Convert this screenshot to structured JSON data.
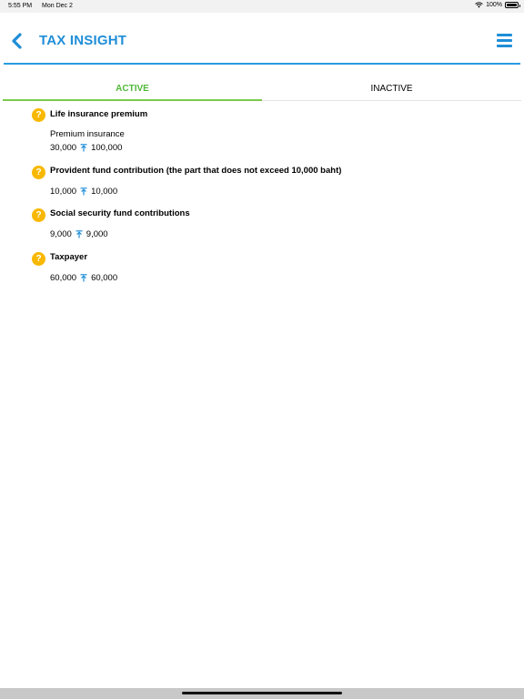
{
  "status_bar": {
    "time": "5:55 PM",
    "date": "Mon Dec 2",
    "battery": "100%"
  },
  "header": {
    "title": "TAX INSIGHT",
    "back_icon": "chevron-left-icon",
    "menu_icon": "hamburger-menu-icon",
    "accent_color": "#1f8ed8"
  },
  "tabs": [
    {
      "label": "ACTIVE",
      "selected": true,
      "color": "#52b83b"
    },
    {
      "label": "INACTIVE",
      "selected": false
    }
  ],
  "items": [
    {
      "title": "Life insurance premium",
      "subtitle": "Premium insurance",
      "from": "30,000",
      "to": "100,000"
    },
    {
      "title": "Provident fund contribution (the part that does not exceed 10,000 baht)",
      "from": "10,000",
      "to": "10,000"
    },
    {
      "title": "Social security fund contributions",
      "from": "9,000",
      "to": "9,000"
    },
    {
      "title": "Taxpayer",
      "from": "60,000",
      "to": "60,000"
    }
  ],
  "help_icon": {
    "glyph": "?",
    "color": "#f9b800"
  }
}
